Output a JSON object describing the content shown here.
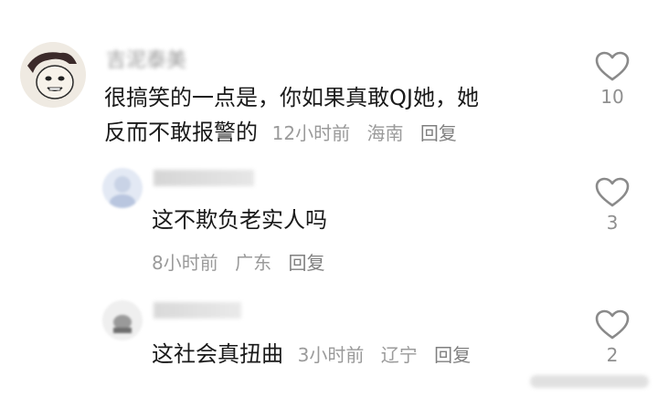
{
  "comments": [
    {
      "username": "吉泥泰美",
      "text_line1": "很搞笑的一点是，你如果真敢QJ她，她",
      "text_line2": "反而不敢报警的",
      "time": "12小时前",
      "location": "海南",
      "reply_label": "回复",
      "likes": "10"
    },
    {
      "username": "",
      "text": "这不欺负老实人吗",
      "time": "8小时前",
      "location": "广东",
      "reply_label": "回复",
      "likes": "3"
    },
    {
      "username": "",
      "text": "这社会真扭曲",
      "time": "3小时前",
      "location": "辽宁",
      "reply_label": "回复",
      "likes": "2"
    }
  ],
  "icons": {
    "like": "heart-outline-icon",
    "avatar1": "meme-face-avatar",
    "avatar2": "blurred-avatar",
    "avatar3": "blurred-avatar"
  },
  "colors": {
    "text": "#1a1a1a",
    "meta": "#9a9a9a",
    "heart_stroke": "#8a8a8a"
  }
}
